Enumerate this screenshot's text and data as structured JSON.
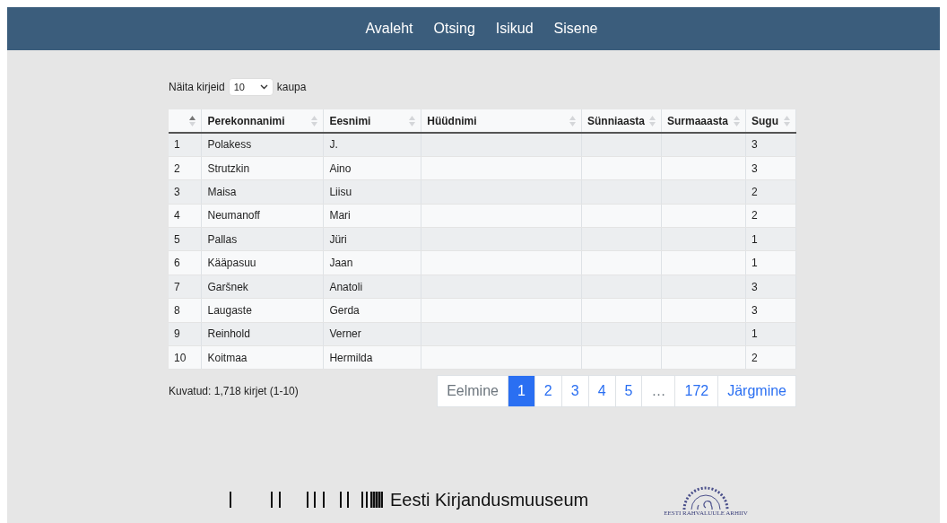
{
  "nav": {
    "items": [
      "Avaleht",
      "Otsing",
      "Isikud",
      "Sisene"
    ]
  },
  "length_control": {
    "before": "Näita kirjeid",
    "value": "10",
    "after": "kaupa"
  },
  "table": {
    "columns": [
      {
        "sorted": true
      },
      {
        "label": "Perekonnanimi",
        "sorted": false
      },
      {
        "label": "Eesnimi",
        "sorted": false
      },
      {
        "label": "Hüüdnimi",
        "sorted": false
      },
      {
        "label": "Sünniaasta",
        "sorted": false
      },
      {
        "label": "Surmaaasta",
        "sorted": false
      },
      {
        "label": "Sugu",
        "sorted": false
      }
    ],
    "rows": [
      {
        "number": "1",
        "surname": "Polakess",
        "first_name": "J.",
        "sex": "3"
      },
      {
        "number": "2",
        "surname": "Strutzkin",
        "first_name": "Aino",
        "sex": "3"
      },
      {
        "number": "3",
        "surname": "Maisa",
        "first_name": "Liisu",
        "sex": "2"
      },
      {
        "number": "4",
        "surname": "Neumanoff",
        "first_name": "Mari",
        "sex": "2"
      },
      {
        "number": "5",
        "surname": "Pallas",
        "first_name": "Jüri",
        "sex": "1"
      },
      {
        "number": "6",
        "surname": "Kääpasuu",
        "first_name": "Jaan",
        "sex": "1"
      },
      {
        "number": "7",
        "surname": "Garšnek",
        "first_name": "Anatoli",
        "sex": "3"
      },
      {
        "number": "8",
        "surname": "Laugaste",
        "first_name": "Gerda",
        "sex": "3"
      },
      {
        "number": "9",
        "surname": "Reinhold",
        "first_name": "Verner",
        "sex": "1"
      },
      {
        "number": "10",
        "surname": "Koitmaa",
        "first_name": "Hermilda",
        "sex": "2"
      }
    ]
  },
  "info": "Kuvatud: 1,718 kirjet (1-10)",
  "pagination": [
    {
      "label": "Eelmine",
      "selected": false,
      "disabled": true
    },
    {
      "label": "1",
      "selected": true,
      "disabled": false
    },
    {
      "label": "2",
      "selected": false,
      "disabled": false
    },
    {
      "label": "3",
      "selected": false,
      "disabled": false
    },
    {
      "label": "4",
      "selected": false,
      "disabled": false
    },
    {
      "label": "5",
      "selected": false,
      "disabled": false
    },
    {
      "label": "…",
      "selected": false,
      "disabled": true
    },
    {
      "label": "172",
      "selected": false,
      "disabled": false
    },
    {
      "label": "Järgmine",
      "selected": false,
      "disabled": false
    }
  ],
  "footer": {
    "museum": "Eesti Kirjandusmuuseum",
    "archive": "EESTI RAHVALUULE ARHIIV"
  }
}
